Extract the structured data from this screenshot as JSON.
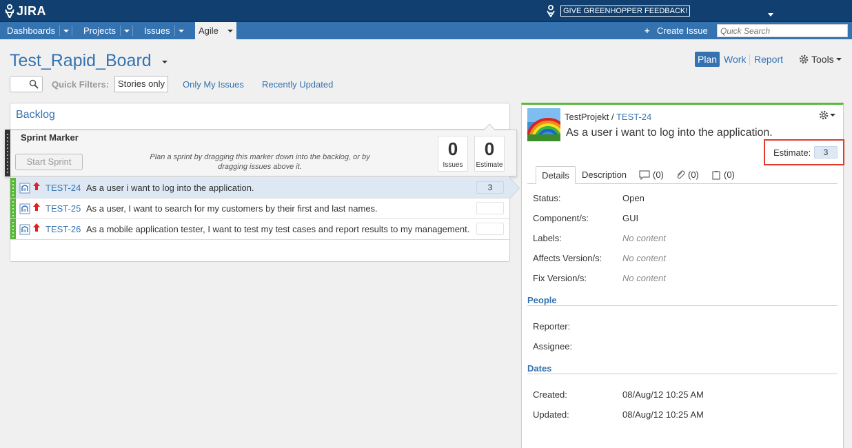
{
  "header": {
    "logo_text": "JIRA",
    "feedback_label": "GIVE GREENHOPPER FEEDBACK!"
  },
  "nav": {
    "dashboards": "Dashboards",
    "projects": "Projects",
    "issues": "Issues",
    "agile": "Agile",
    "create_issue": "Create Issue",
    "quick_search_placeholder": "Quick Search"
  },
  "board": {
    "title": "Test_Rapid_Board",
    "modes": {
      "plan": "Plan",
      "work": "Work",
      "report": "Report",
      "tools": "Tools"
    },
    "quick_filters_label": "Quick Filters:",
    "filters": [
      "Stories only",
      "Only My Issues",
      "Recently Updated"
    ]
  },
  "backlog": {
    "title": "Backlog",
    "sprint_marker": {
      "title": "Sprint Marker",
      "start_label": "Start Sprint",
      "help_text": "Plan a sprint by dragging this marker down into the backlog, or by dragging issues above it.",
      "issues_count": "0",
      "issues_label": "Issues",
      "estimate_count": "0",
      "estimate_label": "Estimate"
    },
    "issues": [
      {
        "key": "TEST-24",
        "summary": "As a user i want to log into the application.",
        "estimate": "3"
      },
      {
        "key": "TEST-25",
        "summary": "As a user, I want to search for my customers by their first and last names.",
        "estimate": ""
      },
      {
        "key": "TEST-26",
        "summary": "As a mobile application tester, I want to test my test cases and report results to my management.",
        "estimate": ""
      }
    ]
  },
  "detail": {
    "project": "TestProjekt",
    "separator": "/",
    "key": "TEST-24",
    "summary": "As a user i want to log into the application.",
    "estimate_label": "Estimate:",
    "estimate_value": "3",
    "tabs": {
      "details": "Details",
      "description": "Description",
      "comments": "(0)",
      "attachments": "(0)",
      "subtasks": "(0)"
    },
    "fields": [
      {
        "label": "Status:",
        "value": "Open"
      },
      {
        "label": "Component/s:",
        "value": "GUI"
      },
      {
        "label": "Labels:",
        "value": "No content"
      },
      {
        "label": "Affects Version/s:",
        "value": "No content"
      },
      {
        "label": "Fix Version/s:",
        "value": "No content"
      }
    ],
    "people_heading": "People",
    "people": [
      {
        "label": "Reporter:",
        "value": ""
      },
      {
        "label": "Assignee:",
        "value": ""
      }
    ],
    "dates_heading": "Dates",
    "dates": [
      {
        "label": "Created:",
        "value": "08/Aug/12 10:25 AM"
      },
      {
        "label": "Updated:",
        "value": "08/Aug/12 10:25 AM"
      }
    ]
  },
  "colors": {
    "header_bg": "#114070",
    "nav_bg": "#3572b0",
    "link": "#3572b0",
    "rank_green": "#59b93a",
    "selected_row": "#dde8f4",
    "highlight_red": "#e03a2b"
  }
}
